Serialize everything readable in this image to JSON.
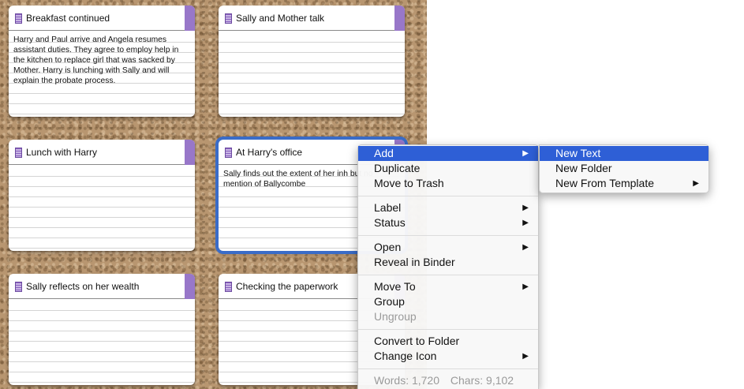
{
  "cards": [
    {
      "title": "Breakfast continued",
      "text": "Harry and Paul arrive and Angela resumes assistant duties. They agree to employ help in the kitchen to replace girl that was sacked by Mother. Harry is lunching with Sally and will explain the probate process."
    },
    {
      "title": "Sally and Mother talk",
      "text": ""
    },
    {
      "title": "Lunch with Harry",
      "text": ""
    },
    {
      "title": "At Harry's office",
      "text": "Sally finds out the extent of her inh but no mention of Ballycombe"
    },
    {
      "title": "Sally reflects on her wealth",
      "text": ""
    },
    {
      "title": "Checking the paperwork",
      "text": ""
    }
  ],
  "context_menu": {
    "add": "Add",
    "duplicate": "Duplicate",
    "move_to_trash": "Move to Trash",
    "label": "Label",
    "status": "Status",
    "open": "Open",
    "reveal_in_binder": "Reveal in Binder",
    "move_to": "Move To",
    "group": "Group",
    "ungroup": "Ungroup",
    "convert_to_folder": "Convert to Folder",
    "change_icon": "Change Icon",
    "words": "Words: 1,720",
    "chars": "Chars: 9,102"
  },
  "add_submenu": {
    "new_text": "New Text",
    "new_folder": "New Folder",
    "new_from_template": "New From Template"
  },
  "colors": {
    "label_strip": "#9877c9",
    "selection": "#3a6cc8",
    "menu_highlight": "#2e5fd6"
  }
}
